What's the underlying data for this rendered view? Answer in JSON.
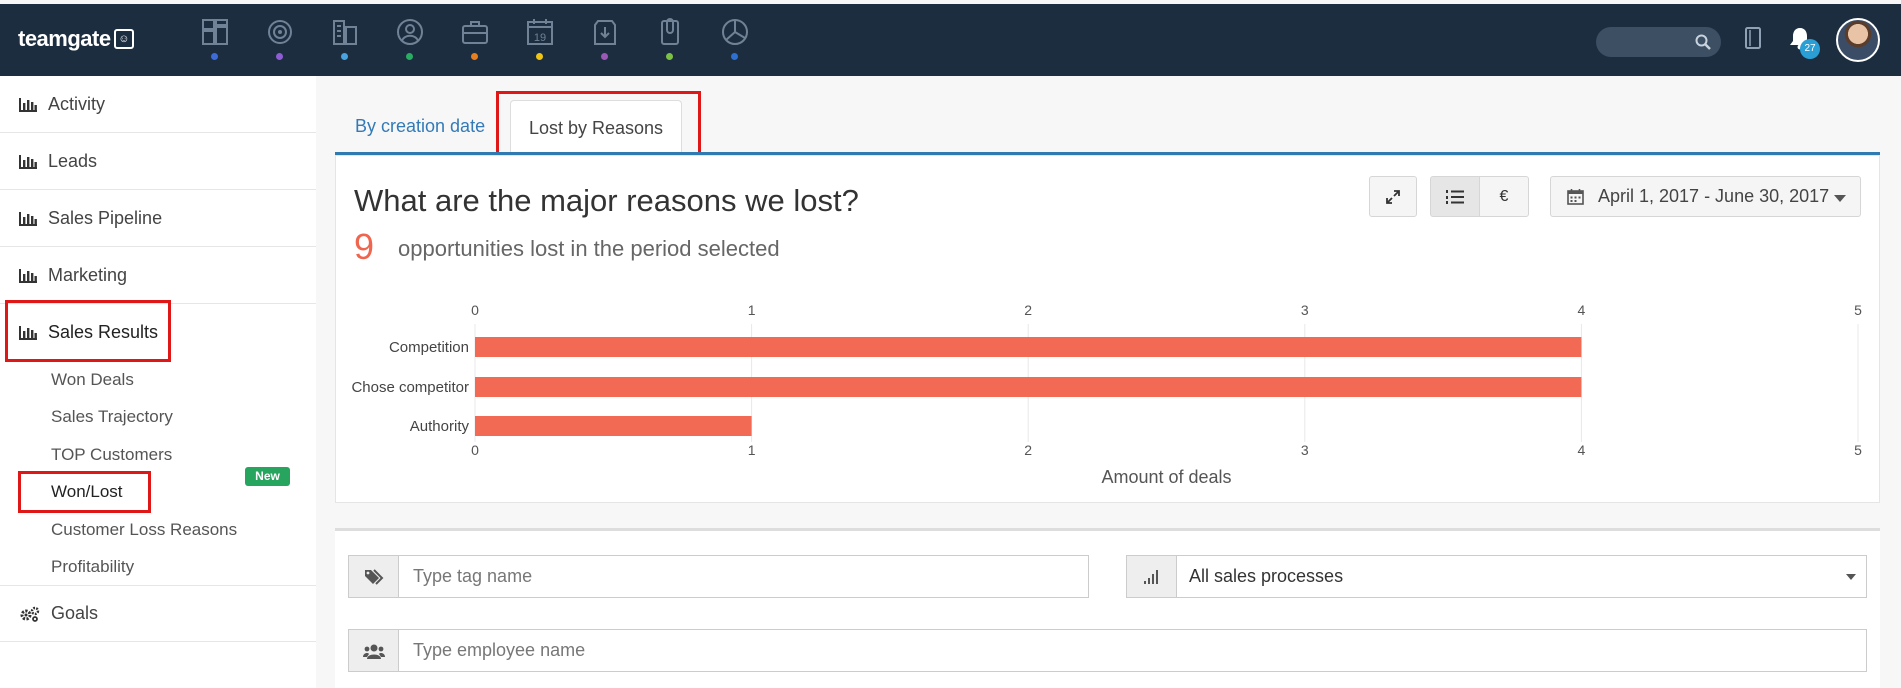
{
  "app": {
    "logo_text": "teamgate",
    "logo_mark": "☺",
    "notification_count": "27",
    "nav_icons": [
      {
        "name": "dashboard-icon",
        "dot": "#3f6bd6"
      },
      {
        "name": "target-icon",
        "dot": "#8f5bd6"
      },
      {
        "name": "companies-icon",
        "dot": "#4aa3df"
      },
      {
        "name": "contacts-icon",
        "dot": "#27ae60"
      },
      {
        "name": "deals-icon",
        "dot": "#e67e22"
      },
      {
        "name": "calendar-icon",
        "dot": "#f1c40f",
        "text": "19"
      },
      {
        "name": "inbox-icon",
        "dot": "#9b59b6"
      },
      {
        "name": "documents-icon",
        "dot": "#7cc242"
      },
      {
        "name": "reports-icon",
        "dot": "#2f6fcf"
      }
    ]
  },
  "sidebar": {
    "items": [
      {
        "label": "Activity"
      },
      {
        "label": "Leads"
      },
      {
        "label": "Sales Pipeline"
      },
      {
        "label": "Marketing"
      },
      {
        "label": "Sales Results"
      },
      {
        "label": "Goals"
      }
    ],
    "sub_items": [
      {
        "label": "Won Deals"
      },
      {
        "label": "Sales Trajectory"
      },
      {
        "label": "TOP Customers"
      },
      {
        "label": "Won/Lost"
      },
      {
        "label": "Customer Loss Reasons"
      },
      {
        "label": "Profitability"
      }
    ],
    "new_badge": "New"
  },
  "tabs": [
    {
      "label": "By creation date"
    },
    {
      "label": "Lost by Reasons"
    }
  ],
  "report": {
    "title": "What are the major reasons we lost?",
    "count": "9",
    "count_text": "opportunities lost in the period selected",
    "currency_label": "€",
    "date_range": "April 1, 2017 - June 30, 2017"
  },
  "chart_data": {
    "type": "bar",
    "orientation": "horizontal",
    "categories": [
      "Competition",
      "Chose competitor",
      "Authority"
    ],
    "values": [
      4,
      4,
      1
    ],
    "xlabel": "Amount of deals",
    "xlim": [
      0,
      5
    ],
    "ticks": [
      0,
      1,
      2,
      3,
      4,
      5
    ],
    "bar_color": "#f26a54",
    "grid": true,
    "title": ""
  },
  "filters": {
    "tag_placeholder": "Type tag name",
    "process_value": "All sales processes",
    "employee_placeholder": "Type employee name"
  }
}
